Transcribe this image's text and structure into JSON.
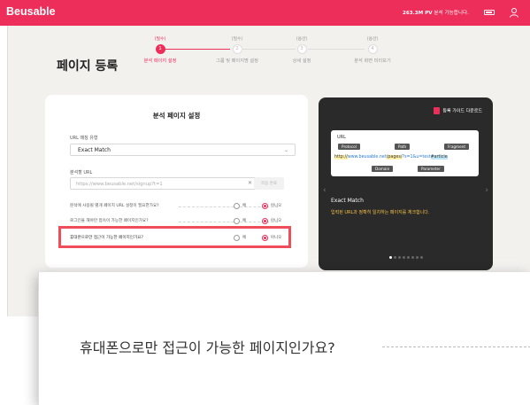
{
  "header": {
    "logo": "Beusable",
    "pv_amount": "263.3M PV",
    "pv_suffix": "분석 가능합니다.",
    "battery_icon": "battery-icon",
    "user_icon": "user-icon"
  },
  "page": {
    "title": "페이지 등록"
  },
  "steps": [
    {
      "tag": "(필수)",
      "number": "1",
      "label": "분석 페이지 설정",
      "active": true
    },
    {
      "tag": "(필수)",
      "number": "2",
      "label": "그룹 및 페이지명 설정",
      "active": false
    },
    {
      "tag": "(옵션)",
      "number": "3",
      "label": "상세 설정",
      "active": false
    },
    {
      "tag": "(옵션)",
      "number": "4",
      "label": "분석 화면 미리보기",
      "active": false
    }
  ],
  "settings": {
    "title": "분석 페이지 설정",
    "url_match_label": "URL 매칭 유형",
    "url_match_value": "Exact Match",
    "analysis_url_label": "분석할 URL",
    "analysis_url_placeholder": "https://www.beusable.net/signup?t=1",
    "apply_label": "적용 완료",
    "questions": [
      {
        "text": "분석에 사용될 별개 페이지 URL 설정이 필요한가요?",
        "yes": "예",
        "no": "아니오",
        "selected": "no"
      },
      {
        "text": "로그인을 해야만 접속이 가능한 페이지인가요?",
        "yes": "예",
        "no": "아니오",
        "selected": "no"
      },
      {
        "text": "휴대폰으로만 접근이 가능한 페이지인가요?",
        "yes": "예",
        "no": "아니오",
        "selected": "no"
      }
    ]
  },
  "guide": {
    "download_label": "등록 가이드 다운로드",
    "url_title": "URL",
    "tags": {
      "protocol": "Protocol",
      "path": "Path",
      "fragment": "Fragment",
      "domain": "Domain",
      "parameter": "Parameter"
    },
    "url_parts": {
      "protocol": "http://",
      "domain": "www.beusable.net",
      "path": "/pages/",
      "param": "?s=1&u=test",
      "fragment": "#article"
    },
    "subtitle": "Exact Match",
    "description": "입력된 URL과 정확히 일치하는 페이지를 체크합니다."
  },
  "zoom": {
    "text": "휴대폰으로만 접근이 가능한 페이지인가요?"
  },
  "colors": {
    "accent": "#ed2d5a",
    "highlight_border": "#f04d5a",
    "guide_bg": "#2a2a2a"
  }
}
